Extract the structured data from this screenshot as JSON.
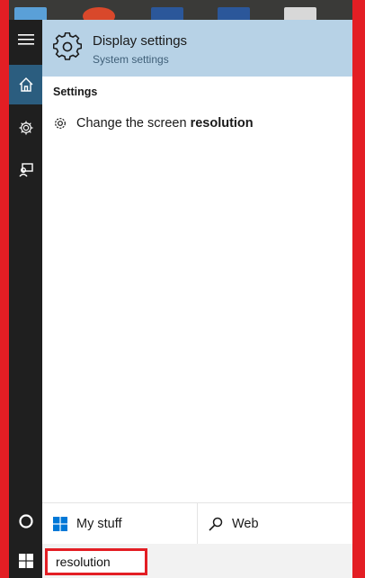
{
  "best_match": {
    "title": "Display settings",
    "subtitle": "System settings",
    "icon": "gear-icon"
  },
  "section_header": "Settings",
  "results": [
    {
      "text_plain": "Change the screen ",
      "text_bold": "resolution",
      "icon": "gear-icon"
    }
  ],
  "bottom": {
    "my_stuff": "My stuff",
    "web": "Web"
  },
  "search": {
    "value": "resolution"
  },
  "colors": {
    "highlight": "#b7d2e6",
    "rail": "#1f1f1f",
    "rail_active": "#2b5d7f",
    "annotation": "#e31e24"
  }
}
